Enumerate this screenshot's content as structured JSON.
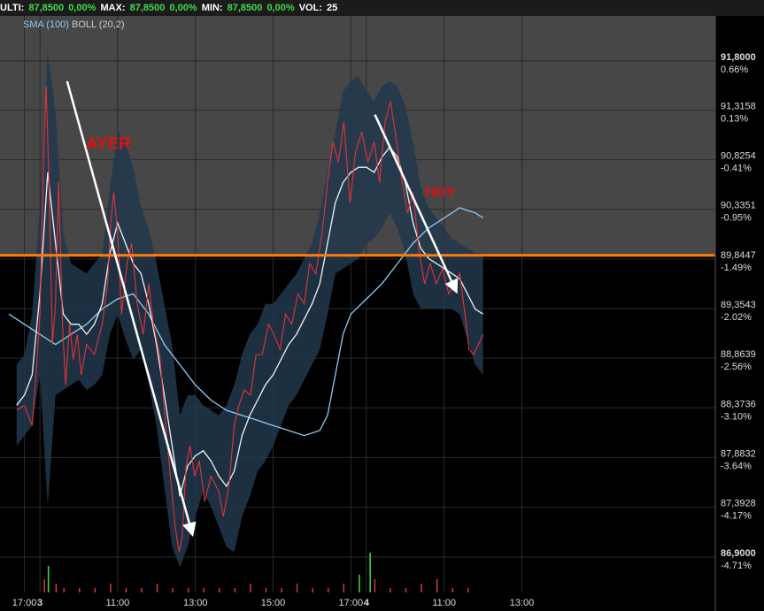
{
  "header": {
    "ulti_label": "ULTI:",
    "ulti_value": "87,8500",
    "ulti_pct": "0,00%",
    "max_label": "MAX:",
    "max_value": "87,8500",
    "max_pct": "0,00%",
    "min_label": "MIN:",
    "min_value": "87,8500",
    "min_pct": "0,00%",
    "vol_label": "VOL:",
    "vol_value": "25"
  },
  "legend": {
    "sma": "SMA (100)",
    "boll": "BOLL (20,2)"
  },
  "colors": {
    "price": "#e0343a",
    "sma": "#8ecbf2",
    "boll_mid": "#f2f2f2",
    "band": "#22384d",
    "level": "#ff7d0d",
    "arrow": "#ffffff",
    "pos": "#3ddc4a",
    "neg": "#ff4040"
  },
  "chart_data": {
    "type": "line",
    "y_axis": {
      "range": [
        86.8,
        92.05
      ],
      "ticks": [
        {
          "value": 91.8,
          "label": "91,8000",
          "pct": "0.66%",
          "highlight": true
        },
        {
          "value": 91.3158,
          "label": "91,3158",
          "pct": "0.13%"
        },
        {
          "value": 90.8254,
          "label": "90,8254",
          "pct": "-0.41%"
        },
        {
          "value": 90.3351,
          "label": "90,3351",
          "pct": "-0.95%"
        },
        {
          "value": 89.8447,
          "label": "89,8447",
          "pct": "-1.49%"
        },
        {
          "value": 89.3543,
          "label": "89,3543",
          "pct": "-2.02%"
        },
        {
          "value": 88.8639,
          "label": "88,8639",
          "pct": "-2.56%"
        },
        {
          "value": 88.3736,
          "label": "88,3736",
          "pct": "-3.10%"
        },
        {
          "value": 87.8832,
          "label": "87,8832",
          "pct": "-3.64%"
        },
        {
          "value": 87.3928,
          "label": "87,3928",
          "pct": "-4.17%"
        },
        {
          "value": 86.9,
          "label": "86,9000",
          "pct": "-4.71%",
          "highlight": true
        }
      ]
    },
    "x_axis": {
      "ticks": [
        {
          "label": "17:00",
          "t": 0
        },
        {
          "label": "3",
          "t": 2,
          "bold": true
        },
        {
          "label": "11:00",
          "t": 12
        },
        {
          "label": "13:00",
          "t": 22
        },
        {
          "label": "15:00",
          "t": 32
        },
        {
          "label": "17:00",
          "t": 42
        },
        {
          "label": "4",
          "t": 44,
          "bold": true
        },
        {
          "label": "11:00",
          "t": 54
        },
        {
          "label": "13:00",
          "t": 64
        }
      ]
    },
    "reference_level": 89.88,
    "price": [
      [
        -1,
        88.35
      ],
      [
        0,
        88.4
      ],
      [
        1,
        88.2
      ],
      [
        1.5,
        88.7
      ],
      [
        2,
        89.3
      ],
      [
        2.5,
        90.9
      ],
      [
        2.8,
        91.55
      ],
      [
        3.2,
        90.5
      ],
      [
        3.6,
        89.0
      ],
      [
        4,
        89.4
      ],
      [
        4.4,
        90.6
      ],
      [
        4.9,
        89.2
      ],
      [
        5.3,
        88.6
      ],
      [
        5.8,
        89.2
      ],
      [
        6.3,
        88.85
      ],
      [
        6.8,
        89.1
      ],
      [
        7.3,
        88.7
      ],
      [
        8,
        89.0
      ],
      [
        9,
        88.9
      ],
      [
        10,
        89.2
      ],
      [
        10.7,
        89.6
      ],
      [
        11.1,
        90.2
      ],
      [
        11.5,
        90.5
      ],
      [
        12,
        90.1
      ],
      [
        12.5,
        89.3
      ],
      [
        13.2,
        89.8
      ],
      [
        13.8,
        90.0
      ],
      [
        14.5,
        89.4
      ],
      [
        15.3,
        89.1
      ],
      [
        16,
        89.6
      ],
      [
        16.6,
        89.2
      ],
      [
        17.4,
        88.9
      ],
      [
        18.3,
        88.1
      ],
      [
        18.9,
        87.6
      ],
      [
        19.4,
        87.2
      ],
      [
        19.9,
        86.95
      ],
      [
        20.3,
        87.1
      ],
      [
        20.8,
        87.8
      ],
      [
        21.3,
        88.0
      ],
      [
        21.9,
        87.7
      ],
      [
        22.5,
        87.85
      ],
      [
        23.2,
        87.45
      ],
      [
        24,
        87.7
      ],
      [
        25,
        87.55
      ],
      [
        25.6,
        87.3
      ],
      [
        26.3,
        87.6
      ],
      [
        27,
        88.2
      ],
      [
        27.6,
        88.4
      ],
      [
        28.3,
        88.55
      ],
      [
        29.1,
        88.5
      ],
      [
        29.8,
        88.9
      ],
      [
        30.6,
        88.9
      ],
      [
        31.4,
        89.2
      ],
      [
        32.1,
        89.1
      ],
      [
        32.9,
        88.95
      ],
      [
        33.6,
        89.3
      ],
      [
        34.4,
        89.2
      ],
      [
        35.2,
        89.5
      ],
      [
        36,
        89.4
      ],
      [
        36.7,
        89.8
      ],
      [
        37.5,
        89.7
      ],
      [
        38.3,
        90.1
      ],
      [
        39,
        90.6
      ],
      [
        39.7,
        91.0
      ],
      [
        40.4,
        90.8
      ],
      [
        41.1,
        91.2
      ],
      [
        41.9,
        90.4
      ],
      [
        42.6,
        90.9
      ],
      [
        43.4,
        91.1
      ],
      [
        44.2,
        90.8
      ],
      [
        45,
        91.0
      ],
      [
        45.7,
        90.6
      ],
      [
        46.4,
        91.2
      ],
      [
        47.1,
        91.4
      ],
      [
        47.9,
        91.0
      ],
      [
        48.6,
        90.6
      ],
      [
        49.3,
        90.3
      ],
      [
        50,
        90.5
      ],
      [
        50.8,
        89.9
      ],
      [
        51.5,
        89.6
      ],
      [
        52.2,
        89.8
      ],
      [
        53,
        89.6
      ],
      [
        53.8,
        89.75
      ],
      [
        54.6,
        89.5
      ],
      [
        55.4,
        89.6
      ],
      [
        56,
        89.7
      ],
      [
        56.6,
        89.35
      ],
      [
        57.2,
        88.95
      ],
      [
        57.8,
        88.9
      ],
      [
        58.4,
        89.0
      ],
      [
        59,
        89.1
      ]
    ],
    "sma_100": [
      [
        -2,
        89.3
      ],
      [
        0,
        89.2
      ],
      [
        2,
        89.1
      ],
      [
        4,
        89.0
      ],
      [
        6,
        89.1
      ],
      [
        8,
        89.2
      ],
      [
        10,
        89.35
      ],
      [
        12,
        89.45
      ],
      [
        14,
        89.5
      ],
      [
        16,
        89.3
      ],
      [
        18,
        89.0
      ],
      [
        20,
        88.8
      ],
      [
        22,
        88.6
      ],
      [
        24,
        88.45
      ],
      [
        26,
        88.35
      ],
      [
        28,
        88.3
      ],
      [
        30,
        88.25
      ],
      [
        32,
        88.2
      ],
      [
        34,
        88.15
      ],
      [
        36,
        88.1
      ],
      [
        38,
        88.15
      ],
      [
        39,
        88.3
      ],
      [
        40,
        88.7
      ],
      [
        41,
        89.1
      ],
      [
        42,
        89.3
      ],
      [
        44,
        89.45
      ],
      [
        46,
        89.6
      ],
      [
        48,
        89.8
      ],
      [
        50,
        90.0
      ],
      [
        52,
        90.15
      ],
      [
        54,
        90.25
      ],
      [
        56,
        90.35
      ],
      [
        58,
        90.3
      ],
      [
        59,
        90.25
      ]
    ],
    "boll_mid": [
      [
        -1,
        88.4
      ],
      [
        0,
        88.5
      ],
      [
        1,
        88.7
      ],
      [
        2,
        89.5
      ],
      [
        3,
        90.7
      ],
      [
        4,
        90.0
      ],
      [
        5,
        89.3
      ],
      [
        6,
        89.2
      ],
      [
        7,
        89.2
      ],
      [
        8,
        89.1
      ],
      [
        9,
        89.2
      ],
      [
        10,
        89.4
      ],
      [
        11,
        89.9
      ],
      [
        12,
        90.2
      ],
      [
        13,
        90.0
      ],
      [
        14,
        89.8
      ],
      [
        15,
        89.7
      ],
      [
        16,
        89.4
      ],
      [
        17,
        89.0
      ],
      [
        18,
        88.5
      ],
      [
        19,
        88.0
      ],
      [
        20,
        87.5
      ],
      [
        21,
        87.8
      ],
      [
        22,
        87.9
      ],
      [
        23,
        87.95
      ],
      [
        24,
        87.85
      ],
      [
        25,
        87.7
      ],
      [
        26,
        87.6
      ],
      [
        27,
        87.75
      ],
      [
        28,
        88.1
      ],
      [
        29,
        88.3
      ],
      [
        30,
        88.45
      ],
      [
        31,
        88.6
      ],
      [
        32,
        88.7
      ],
      [
        33,
        88.85
      ],
      [
        34,
        89.0
      ],
      [
        35,
        89.1
      ],
      [
        36,
        89.25
      ],
      [
        37,
        89.4
      ],
      [
        38,
        89.6
      ],
      [
        39,
        90.0
      ],
      [
        40,
        90.4
      ],
      [
        41,
        90.6
      ],
      [
        42,
        90.7
      ],
      [
        43,
        90.75
      ],
      [
        44,
        90.75
      ],
      [
        45,
        90.7
      ],
      [
        46,
        90.85
      ],
      [
        47,
        90.95
      ],
      [
        48,
        90.85
      ],
      [
        49,
        90.6
      ],
      [
        50,
        90.2
      ],
      [
        51,
        89.95
      ],
      [
        52,
        89.85
      ],
      [
        53,
        89.8
      ],
      [
        54,
        89.75
      ],
      [
        55,
        89.7
      ],
      [
        56,
        89.65
      ],
      [
        57,
        89.5
      ],
      [
        58,
        89.35
      ],
      [
        59,
        89.3
      ]
    ],
    "boll_upper": [
      [
        -1,
        88.8
      ],
      [
        0,
        88.9
      ],
      [
        1,
        89.3
      ],
      [
        2,
        90.4
      ],
      [
        3,
        91.9
      ],
      [
        4,
        91.3
      ],
      [
        5,
        90.1
      ],
      [
        6,
        89.8
      ],
      [
        7,
        89.75
      ],
      [
        8,
        89.7
      ],
      [
        9,
        89.8
      ],
      [
        10,
        89.9
      ],
      [
        11,
        90.55
      ],
      [
        12,
        91.1
      ],
      [
        13,
        91.0
      ],
      [
        14,
        90.75
      ],
      [
        15,
        90.35
      ],
      [
        16,
        90.15
      ],
      [
        17,
        89.8
      ],
      [
        18,
        89.4
      ],
      [
        19,
        89.0
      ],
      [
        20,
        88.3
      ],
      [
        21,
        88.5
      ],
      [
        22,
        88.5
      ],
      [
        23,
        88.4
      ],
      [
        24,
        88.35
      ],
      [
        25,
        88.3
      ],
      [
        26,
        88.4
      ],
      [
        27,
        88.6
      ],
      [
        28,
        88.9
      ],
      [
        29,
        89.1
      ],
      [
        30,
        89.2
      ],
      [
        31,
        89.4
      ],
      [
        32,
        89.4
      ],
      [
        33,
        89.5
      ],
      [
        34,
        89.6
      ],
      [
        35,
        89.7
      ],
      [
        36,
        89.85
      ],
      [
        37,
        90.0
      ],
      [
        38,
        90.3
      ],
      [
        39,
        90.7
      ],
      [
        40,
        91.1
      ],
      [
        41,
        91.5
      ],
      [
        42,
        91.6
      ],
      [
        43,
        91.65
      ],
      [
        44,
        91.5
      ],
      [
        45,
        91.4
      ],
      [
        46,
        91.55
      ],
      [
        47,
        91.6
      ],
      [
        48,
        91.55
      ],
      [
        49,
        91.35
      ],
      [
        50,
        91.0
      ],
      [
        51,
        90.55
      ],
      [
        52,
        90.35
      ],
      [
        53,
        90.25
      ],
      [
        54,
        90.15
      ],
      [
        55,
        90.05
      ],
      [
        56,
        90.0
      ],
      [
        57,
        89.95
      ],
      [
        58,
        89.9
      ],
      [
        59,
        89.9
      ]
    ],
    "boll_lower": [
      [
        -1,
        88.0
      ],
      [
        0,
        88.1
      ],
      [
        1,
        88.2
      ],
      [
        2,
        88.7
      ],
      [
        3,
        87.4
      ],
      [
        4,
        88.5
      ],
      [
        5,
        88.55
      ],
      [
        6,
        88.6
      ],
      [
        7,
        88.65
      ],
      [
        8,
        88.55
      ],
      [
        9,
        88.6
      ],
      [
        10,
        88.7
      ],
      [
        11,
        89.1
      ],
      [
        12,
        89.3
      ],
      [
        13,
        89.05
      ],
      [
        14,
        88.85
      ],
      [
        15,
        88.95
      ],
      [
        16,
        88.6
      ],
      [
        17,
        88.2
      ],
      [
        18,
        87.6
      ],
      [
        19,
        87.0
      ],
      [
        20,
        86.8
      ],
      [
        21,
        87.0
      ],
      [
        22,
        87.3
      ],
      [
        23,
        87.55
      ],
      [
        24,
        87.4
      ],
      [
        25,
        87.2
      ],
      [
        26,
        87.0
      ],
      [
        27,
        86.95
      ],
      [
        28,
        87.3
      ],
      [
        29,
        87.5
      ],
      [
        30,
        87.75
      ],
      [
        31,
        87.85
      ],
      [
        32,
        88.0
      ],
      [
        33,
        88.2
      ],
      [
        34,
        88.4
      ],
      [
        35,
        88.5
      ],
      [
        36,
        88.65
      ],
      [
        37,
        88.8
      ],
      [
        38,
        88.95
      ],
      [
        39,
        89.3
      ],
      [
        40,
        89.7
      ],
      [
        41,
        89.75
      ],
      [
        42,
        89.8
      ],
      [
        43,
        89.85
      ],
      [
        44,
        90.0
      ],
      [
        45,
        90.05
      ],
      [
        46,
        90.15
      ],
      [
        47,
        90.3
      ],
      [
        48,
        90.15
      ],
      [
        49,
        89.9
      ],
      [
        50,
        89.5
      ],
      [
        51,
        89.35
      ],
      [
        52,
        89.35
      ],
      [
        53,
        89.35
      ],
      [
        54,
        89.35
      ],
      [
        55,
        89.35
      ],
      [
        56,
        89.3
      ],
      [
        57,
        89.05
      ],
      [
        58,
        88.8
      ],
      [
        59,
        88.7
      ]
    ],
    "annotations": [
      {
        "text": "AYER",
        "t": 10.8,
        "y": 90.93
      },
      {
        "text": "HOY",
        "t": 53.5,
        "y": 90.46
      }
    ],
    "arrows": [
      {
        "from": [
          5.5,
          91.6
        ],
        "to": [
          21.7,
          87.1
        ]
      },
      {
        "from": [
          45.1,
          91.27
        ],
        "to": [
          55.7,
          89.5
        ]
      }
    ],
    "volume": [
      [
        2.5,
        3
      ],
      [
        3,
        6
      ],
      [
        4,
        2
      ],
      [
        5,
        1
      ],
      [
        7,
        1
      ],
      [
        9,
        1
      ],
      [
        11,
        2
      ],
      [
        13,
        1
      ],
      [
        15,
        1
      ],
      [
        17,
        2
      ],
      [
        19,
        1
      ],
      [
        21,
        1
      ],
      [
        23,
        1
      ],
      [
        25,
        1
      ],
      [
        27,
        1
      ],
      [
        29,
        2
      ],
      [
        31,
        1
      ],
      [
        33,
        1
      ],
      [
        35,
        2
      ],
      [
        37,
        1
      ],
      [
        39,
        1
      ],
      [
        41,
        2
      ],
      [
        43,
        4
      ],
      [
        44.4,
        9
      ],
      [
        45,
        3
      ],
      [
        47,
        1
      ],
      [
        49,
        1
      ],
      [
        51,
        2
      ],
      [
        53,
        3
      ],
      [
        55,
        1
      ],
      [
        57,
        1
      ]
    ]
  }
}
